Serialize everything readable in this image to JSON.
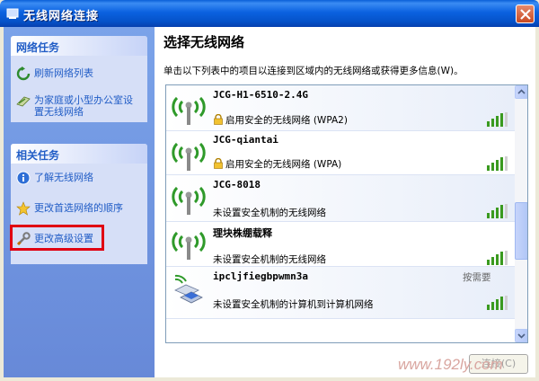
{
  "window": {
    "title": "无线网络连接"
  },
  "sidebar": {
    "network_tasks": {
      "header": "网络任务",
      "items": [
        {
          "label": "刷新网络列表",
          "icon": "refresh-icon"
        },
        {
          "label_line1": "为家庭或小型办公室设",
          "label_line2": "置无线网络",
          "icon": "setup-wizard-icon"
        }
      ]
    },
    "related_tasks": {
      "header": "相关任务",
      "items": [
        {
          "label": "了解无线网络",
          "icon": "info-icon"
        },
        {
          "label": "更改首选网络的顺序",
          "icon": "star-icon"
        },
        {
          "label": "更改高级设置",
          "icon": "wrench-icon"
        }
      ]
    },
    "highlight_color": "#e00012"
  },
  "main": {
    "title": "选择无线网络",
    "description": "单击以下列表中的项目以连接到区域内的无线网络或获得更多信息(W)。",
    "networks": [
      {
        "name": "JCG-H1-6510-2.4G",
        "status": "启用安全的无线网络 (WPA2)",
        "secured": true,
        "type": "access-point",
        "signal_bars": 4
      },
      {
        "name": "JCG-qiantai",
        "status": "启用安全的无线网络 (WPA)",
        "secured": true,
        "type": "access-point",
        "signal_bars": 4
      },
      {
        "name": "JCG-8018",
        "status": "未设置安全机制的无线网络",
        "secured": false,
        "type": "access-point",
        "signal_bars": 4
      },
      {
        "name": "理块株绷载释",
        "status": "未设置安全机制的无线网络",
        "secured": false,
        "type": "access-point",
        "signal_bars": 4
      },
      {
        "name": "ipcljfiegbpwmn3a",
        "status": "未设置安全机制的计算机到计算机网络",
        "secured": false,
        "type": "ad-hoc",
        "signal_bars": 4,
        "extra": "按需要"
      }
    ],
    "connect_button": "连接(C)"
  },
  "watermark": "www.192ly.com",
  "colors": {
    "titlebar": "#0b62e0",
    "sidebar": "#6f92dc",
    "task_link": "#215dc6",
    "signal_green": "#3a9a1f"
  }
}
